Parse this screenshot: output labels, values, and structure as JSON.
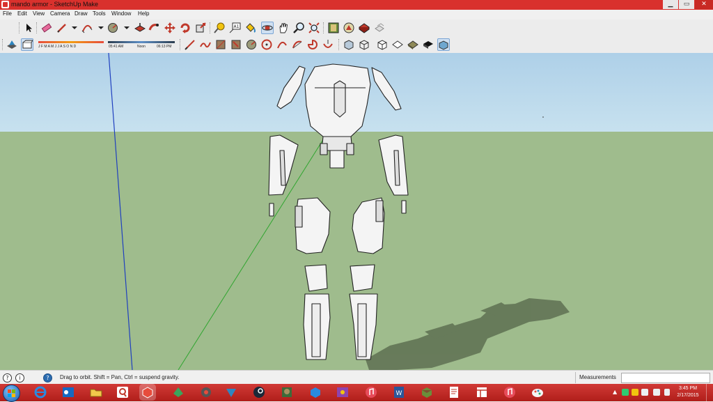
{
  "window": {
    "title": "mando armor - SketchUp Make"
  },
  "menu": [
    "File",
    "Edit",
    "View",
    "Camera",
    "Draw",
    "Tools",
    "Window",
    "Help"
  ],
  "shadows": {
    "months": "J F M A M J J A S O N D",
    "time_start": "05:41 AM",
    "time_mid": "Noon",
    "time_end": "06:13 PM"
  },
  "status": {
    "hint": "Drag to orbit. Shift = Pan, Ctrl = suspend gravity.",
    "measurements_label": "Measurements",
    "measurements_value": ""
  },
  "taskbar": {
    "time": "3:45 PM",
    "date": "2/17/2015"
  },
  "colors": {
    "title_bar": "#d9312d",
    "taskbar": "#b01e1a",
    "sky": "#b8d8ec",
    "ground": "#9fbc8d",
    "active_tool": "#cfe0f2"
  },
  "icons": {
    "toolbar1": [
      "select-arrow-icon",
      "eraser-icon",
      "pencil-line-icon",
      "arc-icon",
      "shape-circle-icon",
      "push-pull-icon",
      "follow-me-icon",
      "move-icon",
      "rotate-icon",
      "scale-icon",
      "tape-measure-icon",
      "text-icon",
      "paint-bucket-icon",
      "orbit-icon",
      "pan-icon",
      "zoom-icon",
      "zoom-extents-icon",
      "model-info-icon",
      "warehouse-icon",
      "extension-warehouse-icon",
      "layout-icon"
    ],
    "toolbar2": [
      "shadows-toggle-icon",
      "fog-icon",
      "sandbox-from-contours-icon",
      "sandbox-from-scratch-icon",
      "smoove-icon",
      "stamp-icon",
      "drape-icon",
      "add-detail-icon",
      "flip-edge-icon",
      "arc-2pt-icon",
      "pie-icon",
      "3pt-arc-icon",
      "xray-icon",
      "wireframe-icon",
      "hidden-line-icon",
      "shaded-icon",
      "shaded-textures-icon",
      "monochrome-icon"
    ]
  }
}
